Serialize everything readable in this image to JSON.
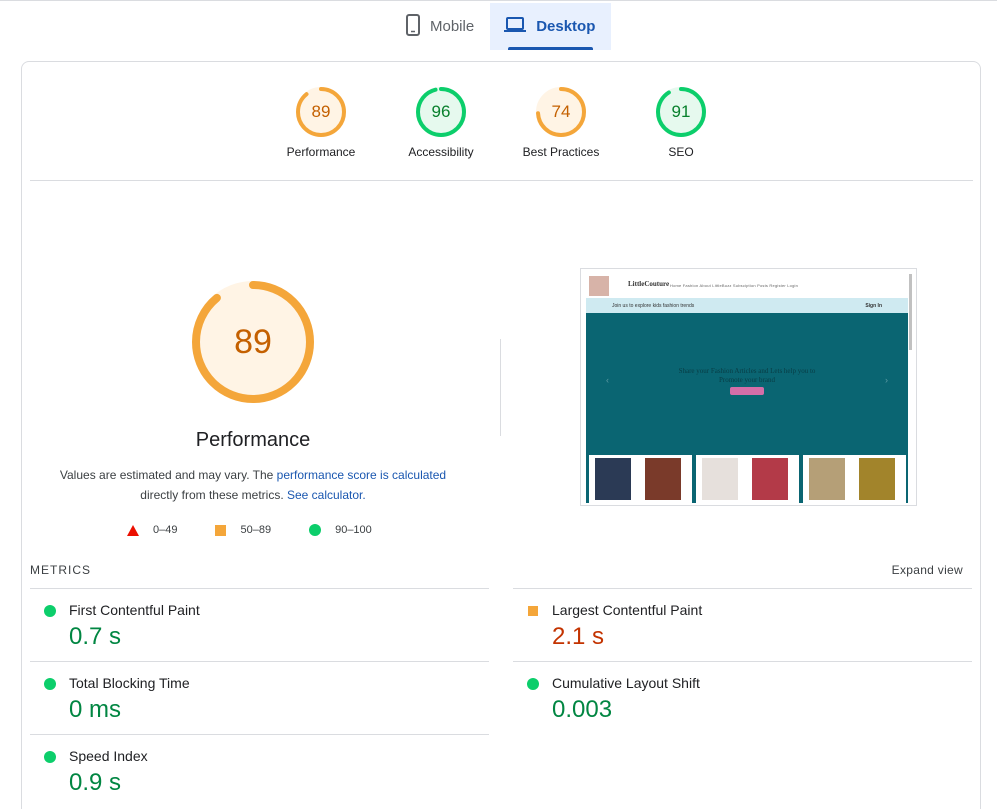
{
  "device_tabs": [
    {
      "label": "Mobile",
      "icon": "smartphone-icon",
      "active": false
    },
    {
      "label": "Desktop",
      "icon": "laptop-icon",
      "active": true
    }
  ],
  "categories": [
    {
      "name": "Performance",
      "score": "89",
      "value": 89,
      "color": "#f4a63a",
      "text_color": "#c46000",
      "fill": "#fff4e5"
    },
    {
      "name": "Accessibility",
      "score": "96",
      "value": 96,
      "color": "#0cce6b",
      "text_color": "#08802c",
      "fill": "#e6f9ee"
    },
    {
      "name": "Best Practices",
      "score": "74",
      "value": 74,
      "color": "#f4a63a",
      "text_color": "#c46000",
      "fill": "#fff4e5"
    },
    {
      "name": "SEO",
      "score": "91",
      "value": 91,
      "color": "#0cce6b",
      "text_color": "#08802c",
      "fill": "#e6f9ee"
    }
  ],
  "main": {
    "score": "89",
    "value": 89,
    "title": "Performance",
    "desc_prefix": "Values are estimated and may vary. The ",
    "desc_link1": "performance score is calculated",
    "desc_middle": "directly from these metrics. ",
    "desc_link2": "See calculator."
  },
  "legend": [
    {
      "shape": "triangle",
      "range": "0–49",
      "color": "#eb0f00"
    },
    {
      "shape": "square",
      "range": "50–89",
      "color": "#f4a63a"
    },
    {
      "shape": "circle",
      "range": "90–100",
      "color": "#0cce6b"
    }
  ],
  "screenshot": {
    "brand": "LittleCouture",
    "menu": "Home  Fashion  About  LittleBuzz  Subsciption  Posts  Register  Login",
    "strip_left": "Join us to explore kids fashion trends",
    "strip_right": "Sign In",
    "hero_text": "Share your Fashion Articles and Lets help you to Promote your brand"
  },
  "metrics": {
    "title": "METRICS",
    "expand_label": "Expand view",
    "items": [
      {
        "name": "First Contentful Paint",
        "value": "0.7 s",
        "rating": "good"
      },
      {
        "name": "Largest Contentful Paint",
        "value": "2.1 s",
        "rating": "average"
      },
      {
        "name": "Total Blocking Time",
        "value": "0 ms",
        "rating": "good"
      },
      {
        "name": "Cumulative Layout Shift",
        "value": "0.003",
        "rating": "good"
      },
      {
        "name": "Speed Index",
        "value": "0.9 s",
        "rating": "good"
      }
    ]
  },
  "colors": {
    "accent": "#1a57b0",
    "pass": "#0cce6b",
    "average": "#f4a63a",
    "fail": "#eb0f00"
  }
}
